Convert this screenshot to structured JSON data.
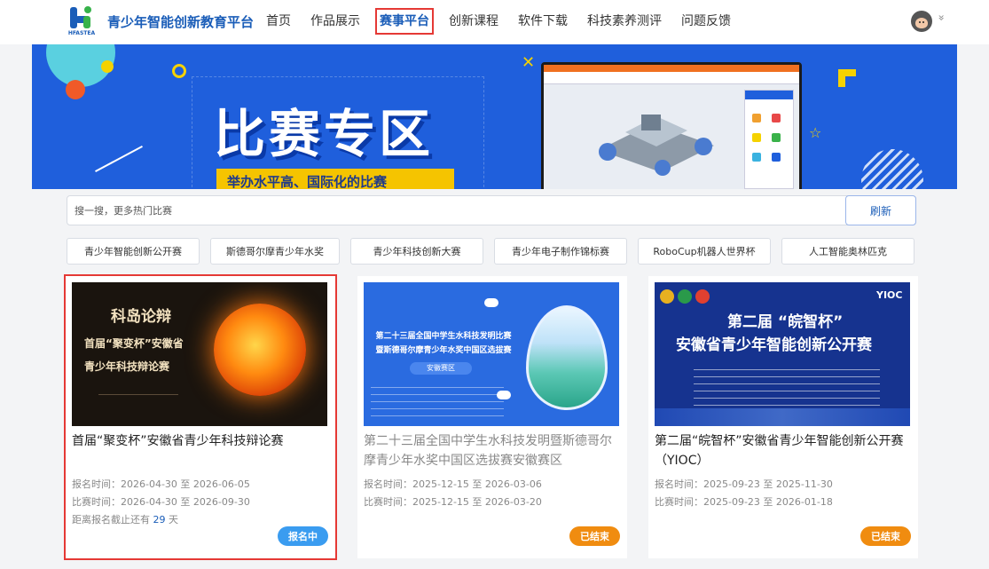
{
  "header": {
    "logo_text": "HFASTEA",
    "site_title": "青少年智能创新教育平台",
    "nav": [
      {
        "label": "首页"
      },
      {
        "label": "作品展示"
      },
      {
        "label": "赛事平台",
        "active": true
      },
      {
        "label": "创新课程"
      },
      {
        "label": "软件下载"
      },
      {
        "label": "科技素养测评"
      },
      {
        "label": "问题反馈"
      }
    ],
    "user_menu_glyph": "»"
  },
  "banner": {
    "title": "比赛专区",
    "subtitle": "举办水平高、国际化的比赛"
  },
  "search": {
    "placeholder": "搜一搜，更多热门比赛",
    "value": "",
    "refresh_label": "刷新"
  },
  "tags": [
    "青少年智能创新公开赛",
    "斯德哥尔摩青少年水奖",
    "青少年科技创新大赛",
    "青少年电子制作锦标赛",
    "RoboCup机器人世界杯",
    "人工智能奥林匹克"
  ],
  "cards": [
    {
      "title": "首届“聚变杯”安徽省青少年科技辩论赛",
      "registration_label": "报名时间：",
      "registration": "2026-04-30 至 2026-06-05",
      "competition_label": "比赛时间：",
      "competition": "2026-04-30 至 2026-09-30",
      "deadline_prefix": "距离报名截止还有",
      "deadline_days": "29",
      "deadline_suffix": "天",
      "status": "报名中",
      "image_text": {
        "line1": "科岛论辩",
        "line2": "首届“聚变杯”安徽省",
        "line3": "青少年科技辩论赛"
      }
    },
    {
      "title": "第二十三届全国中学生水科技发明暨斯德哥尔摩青少年水奖中国区选拔赛安徽赛区",
      "registration_label": "报名时间：",
      "registration": "2025-12-15 至 2026-03-06",
      "competition_label": "比赛时间：",
      "competition": "2025-12-15 至 2026-03-20",
      "status": "已结束",
      "image_text": {
        "line1": "第二十三届全国中学生水科技发明比赛",
        "line2": "暨斯德哥尔摩青少年水奖中国区选拔赛",
        "line3": "安徽赛区"
      }
    },
    {
      "title": "第二届“皖智杯”安徽省青少年智能创新公开赛（YIOC）",
      "registration_label": "报名时间：",
      "registration": "2025-09-23 至 2025-11-30",
      "competition_label": "比赛时间：",
      "competition": "2025-09-23 至 2026-01-18",
      "status": "已结束",
      "image_text": {
        "logo": "YIOC",
        "line1": "第二届 “皖智杯”",
        "line2": "安徽省青少年智能创新公开赛"
      }
    }
  ],
  "colors": {
    "brand": "#1a5db8",
    "banner_bg": "#1f5fdc",
    "selection": "#e53935",
    "open_badge": "#3a9cf0",
    "ended_badge": "#f08c10"
  }
}
